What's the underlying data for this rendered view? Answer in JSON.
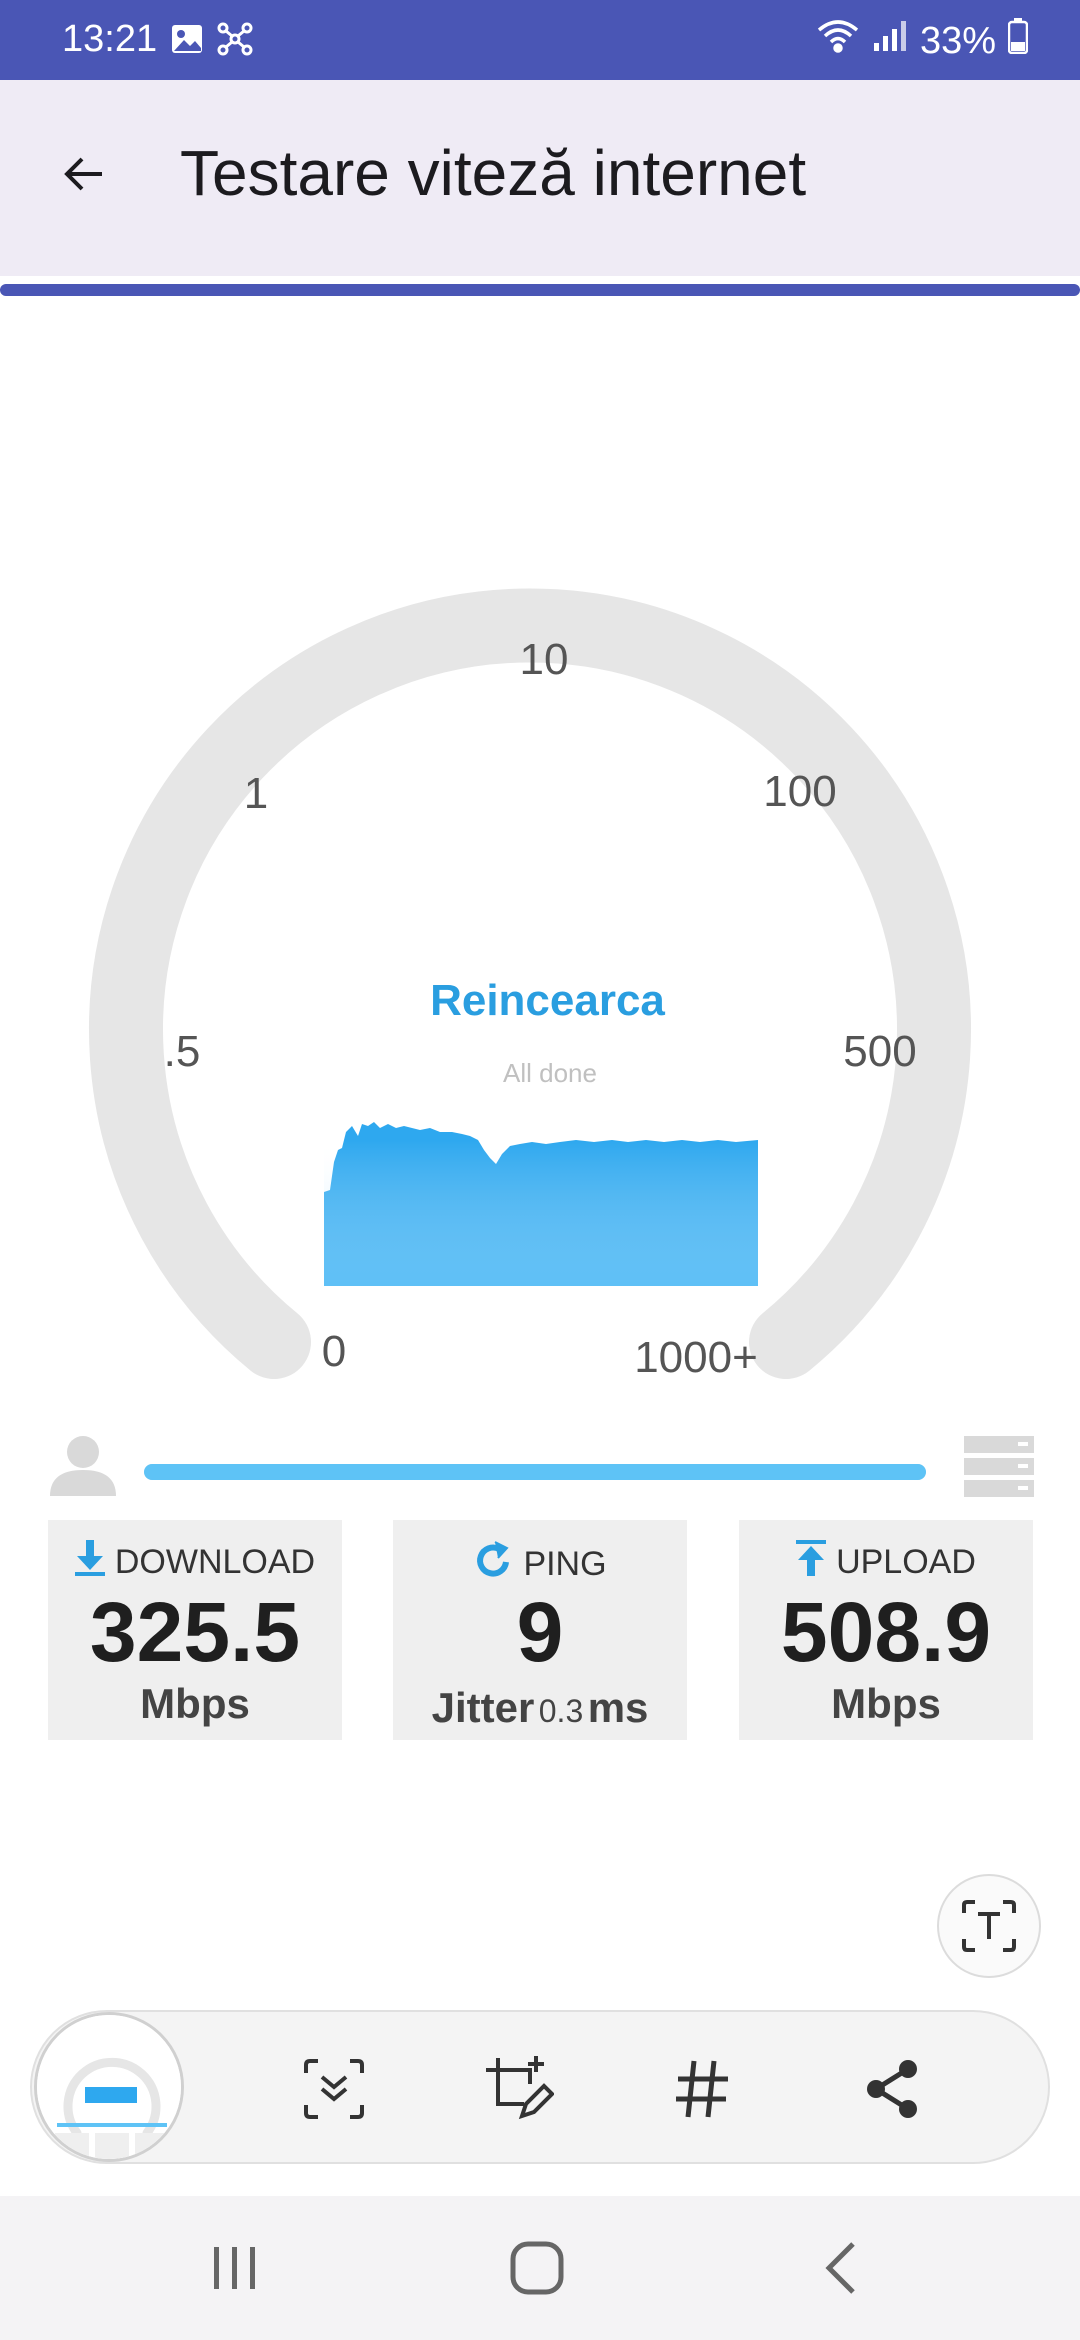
{
  "status_bar": {
    "time": "13:21",
    "battery": "33%",
    "icons": [
      "gallery-icon",
      "connected-nodes-icon",
      "wifi-icon",
      "signal-icon",
      "battery-icon"
    ]
  },
  "app_bar": {
    "title": "Testare viteză internet",
    "back_icon": "arrow-back-icon"
  },
  "gauge": {
    "scale_labels": [
      "0",
      ".5",
      "1",
      "10",
      "100",
      "500",
      "1000+"
    ],
    "action_label": "Reincearca",
    "status_message": "All done",
    "progress_fraction": 1.0
  },
  "results": {
    "download": {
      "label": "DOWNLOAD",
      "value": "325.5",
      "unit": "Mbps",
      "icon": "download-arrow-icon"
    },
    "ping": {
      "label": "PING",
      "value": "9",
      "jitter_label": "Jitter",
      "jitter_value": "0.3",
      "jitter_unit": "ms",
      "icon": "refresh-icon"
    },
    "upload": {
      "label": "UPLOAD",
      "value": "508.9",
      "unit": "Mbps",
      "icon": "upload-arrow-icon"
    }
  },
  "accent_colors": {
    "header": "#4a56b5",
    "accent": "#2a9ee0",
    "graph": "#2ea8ef"
  },
  "toolbar": {
    "items": [
      "screenshot-thumbnail",
      "scroll-capture-icon",
      "crop-edit-icon",
      "hashtag-icon",
      "share-icon"
    ]
  },
  "nav_bar": {
    "items": [
      "recents-icon",
      "home-icon",
      "back-icon"
    ]
  }
}
